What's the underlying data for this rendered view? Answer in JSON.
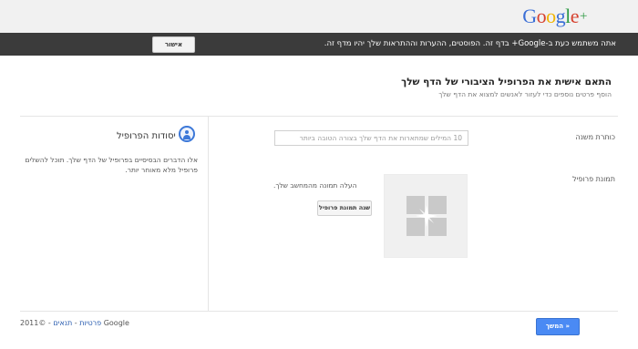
{
  "header": {
    "logo_letters": [
      "G",
      "o",
      "o",
      "g",
      "l",
      "e"
    ],
    "logo_plus": "+"
  },
  "notice": {
    "text": "אתה משתמש כעת ב-Google+ בדף זה. הפוסטים, ההערות וההתראות שלך יהיו מדף זה.",
    "ok_label": "אישור"
  },
  "page": {
    "title": "התאם אישית את הפרופיל הציבורי של הדף שלך",
    "subtitle": "הוסף פרטים נוספים כדי לעזור לאנשים למצוא את הדף שלך"
  },
  "section": {
    "title": "יסודות הפרופיל",
    "icon": "profile-icon",
    "description": "אלו הדברים הבסיסיים בפרופיל של הדף שלך. תוכל להשלים פרופיל מלא מאוחר יותר."
  },
  "form": {
    "tagline_label": "כותרת משנה",
    "tagline_placeholder": "10 המילים שמתארות את הדף שלך בצורה הטובה ביותר",
    "photo_label": "תמונת פרופיל",
    "upload_text": "העלה תמונה מהמחשב שלך.",
    "change_photo_label": "שנה תמונת פרופיל"
  },
  "footer": {
    "copyright": "©2011 Google",
    "separator": " - ",
    "terms_label": "תנאים",
    "privacy_label": "פרטיות",
    "continue_label": "המשך »"
  },
  "colors": {
    "notice_bg": "#3b3b3b",
    "primary_button": "#4a8af4",
    "link": "#2a5db0"
  }
}
